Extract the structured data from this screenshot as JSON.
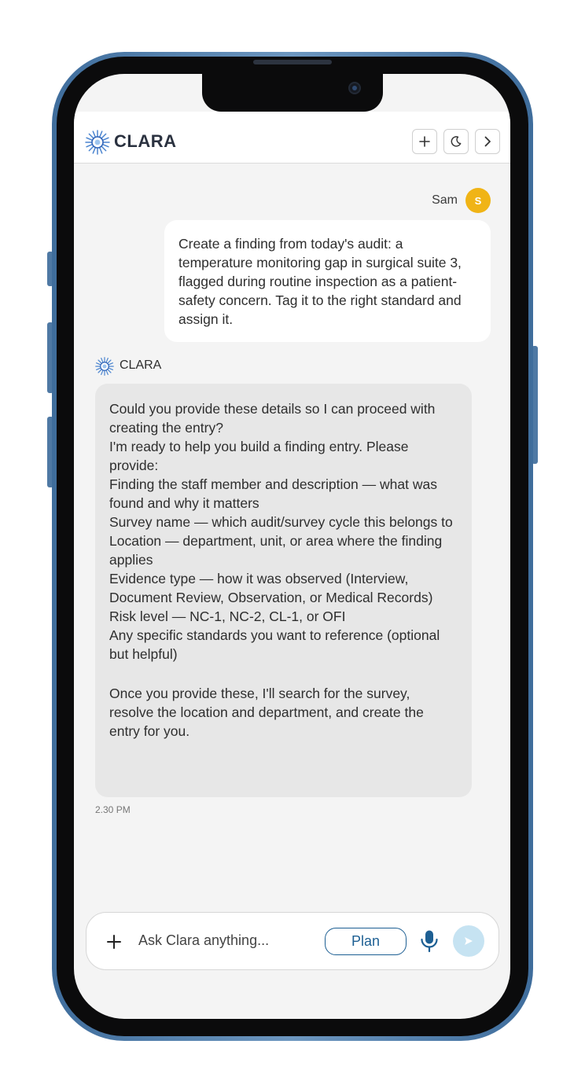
{
  "header": {
    "brand": "CLARA",
    "new_chat_icon": "plus-icon",
    "theme_icon": "moon-icon",
    "next_icon": "chevron-right-icon"
  },
  "user_message": {
    "name": "Sam",
    "avatar_initial": "S",
    "text": "Create a finding from today's audit: a temperature monitoring gap in surgical suite 3, flagged during routine inspection as a patient-safety concern. Tag it to the right standard and assign it."
  },
  "assistant_message": {
    "name": "CLARA",
    "lines": [
      "Could you provide these details so I can proceed with creating the entry?",
      "I'm ready to help you build a finding entry. Please provide:",
      "Finding the staff member and description — what was found and why it matters",
      "Survey name — which audit/survey cycle this belongs to",
      "Location — department, unit, or area where the finding applies",
      "Evidence type — how it was observed (Interview, Document Review, Observation, or Medical Records)",
      "Risk level — NC-1, NC-2, CL-1, or OFI",
      "Any specific standards you want to reference (optional but helpful)"
    ],
    "closing": "Once you provide these, I'll search for the survey, resolve the location and department, and create the entry for you.",
    "timestamp": "2.30 PM"
  },
  "composer": {
    "placeholder": "Ask Clara anything...",
    "plan_label": "Plan",
    "attach_icon": "plus-icon",
    "mic_icon": "microphone-icon",
    "send_icon": "send-icon"
  },
  "colors": {
    "accent": "#1d5f93",
    "avatar": "#f0b416",
    "send_disabled": "#c6e3f2",
    "frame": "#4f79a4"
  }
}
